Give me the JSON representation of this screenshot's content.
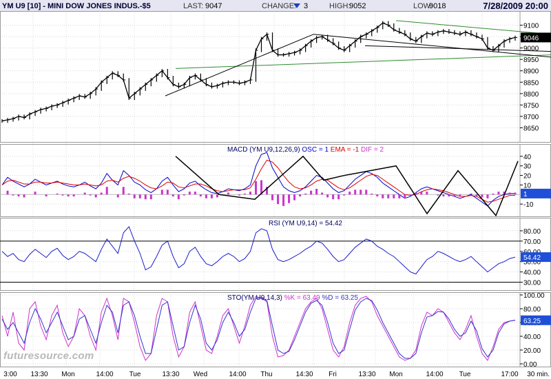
{
  "header": {
    "symbol_title": "YM U9 [10] - MINI DOW JONES INDUS.-$5",
    "last_label": "LAST:",
    "last_value": "9047",
    "change_label": "CHANGE:",
    "change_value": "3",
    "change_icon": "down-triangle-icon",
    "high_label": "HIGH:",
    "high_value": "9052",
    "low_label": "LOW:",
    "low_value": "9018",
    "datetime": "7/28/2009 20:00"
  },
  "watermark": "futuresource.com",
  "colors": {
    "price": "#000000",
    "trend_green": "#2e8b2e",
    "macd_blue": "#0000cc",
    "macd_red": "#dd0000",
    "macd_dif": "#cc33cc",
    "rsi": "#1a1acc",
    "stoch_k": "#cc33cc",
    "stoch_d": "#3333cc",
    "tag_blue": "#1f4fd8"
  },
  "chart_data": [
    {
      "type": "line",
      "title": "YM U9 [10] - MINI DOW JONES INDUS.-$5",
      "ylim": [
        8600,
        9150
      ],
      "yticks": [
        8650,
        8700,
        8750,
        8800,
        8850,
        8900,
        8950,
        9000,
        9050,
        9100
      ],
      "current_label": "9046",
      "x_labels": [
        "3:00",
        "13:30",
        "Mon",
        "14:00",
        "Tue",
        "13:30",
        "Wed",
        "14:00",
        "Thu",
        "14:30",
        "Fri",
        "13:30",
        "Mon",
        "14:00",
        "Tue",
        "17:00"
      ],
      "x_unit": "30 min.",
      "series": [
        {
          "values": [
            8680,
            8685,
            8690,
            8700,
            8695,
            8710,
            8720,
            8730,
            8735,
            8745,
            8750,
            8760,
            8770,
            8780,
            8790,
            8785,
            8800,
            8820,
            8850,
            8870,
            8890,
            8880,
            8860,
            8780,
            8800,
            8820,
            8840,
            8860,
            8880,
            8900,
            8870,
            8840,
            8830,
            8840,
            8870,
            8880,
            8860,
            8840,
            8830,
            8835,
            8845,
            8850,
            8850,
            8845,
            8850,
            8860,
            8990,
            9040,
            9060,
            8990,
            8970,
            8970,
            8975,
            8980,
            8990,
            9010,
            9030,
            9045,
            9050,
            9035,
            9020,
            9000,
            8990,
            9010,
            9030,
            9050,
            9060,
            9075,
            9090,
            9110,
            9100,
            9080,
            9070,
            9060,
            9040,
            9030,
            9050,
            9065,
            9060,
            9070,
            9075,
            9070,
            9065,
            9060,
            9070,
            9060,
            9050,
            9040,
            9000,
            8990,
            9010,
            9030,
            9040,
            9046
          ]
        }
      ],
      "trendlines": 6
    },
    {
      "type": "line",
      "title": "MACD (YM U9,12,26,9)",
      "legend": [
        {
          "label": "OSC = 1",
          "color": "#0000cc"
        },
        {
          "label": "EMA = -1",
          "color": "#dd0000"
        },
        {
          "label": "DIF = 2",
          "color": "#cc33cc"
        }
      ],
      "ylim": [
        -20,
        50
      ],
      "yticks": [
        40,
        30,
        20,
        10,
        -10
      ],
      "current_label": "1",
      "series": [
        {
          "name": "OSC",
          "values": [
            10,
            18,
            14,
            11,
            8,
            11,
            16,
            13,
            10,
            12,
            14,
            11,
            9,
            8,
            10,
            13,
            9,
            6,
            12,
            22,
            15,
            10,
            25,
            20,
            13,
            10,
            5,
            2,
            6,
            14,
            18,
            10,
            3,
            6,
            12,
            14,
            9,
            5,
            2,
            1,
            3,
            6,
            5,
            4,
            6,
            10,
            30,
            42,
            44,
            28,
            18,
            8,
            4,
            2,
            4,
            8,
            14,
            20,
            18,
            12,
            6,
            2,
            4,
            10,
            16,
            20,
            24,
            22,
            18,
            12,
            8,
            4,
            0,
            -4,
            -2,
            2,
            6,
            8,
            6,
            4,
            2,
            0,
            -2,
            -4,
            -2,
            0,
            -4,
            -8,
            -12,
            -6,
            -2,
            0,
            1,
            1
          ]
        },
        {
          "name": "EMA",
          "values": [
            10,
            14,
            15,
            13,
            11,
            11,
            13,
            13,
            12,
            12,
            13,
            12,
            11,
            10,
            10,
            11,
            10,
            9,
            10,
            14,
            15,
            13,
            17,
            19,
            17,
            14,
            10,
            7,
            6,
            9,
            13,
            12,
            8,
            7,
            9,
            11,
            11,
            9,
            6,
            4,
            3,
            4,
            5,
            5,
            5,
            7,
            16,
            27,
            36,
            34,
            28,
            20,
            13,
            8,
            6,
            7,
            10,
            14,
            16,
            15,
            11,
            7,
            5,
            7,
            11,
            15,
            19,
            21,
            20,
            16,
            12,
            8,
            4,
            0,
            -1,
            0,
            3,
            5,
            6,
            5,
            4,
            2,
            0,
            -2,
            -2,
            -1,
            -2,
            -5,
            -8,
            -7,
            -5,
            -3,
            -1,
            -1
          ]
        },
        {
          "name": "DIF",
          "values": [
            0,
            4,
            -1,
            -2,
            -3,
            0,
            3,
            0,
            -2,
            0,
            1,
            -1,
            -2,
            -2,
            0,
            2,
            -1,
            -3,
            2,
            8,
            0,
            -3,
            8,
            1,
            -4,
            -4,
            -5,
            -5,
            0,
            5,
            5,
            -2,
            -5,
            -1,
            3,
            3,
            -2,
            -4,
            -4,
            -3,
            0,
            2,
            0,
            -1,
            1,
            3,
            14,
            15,
            8,
            -6,
            -10,
            -12,
            -9,
            -6,
            -2,
            1,
            4,
            6,
            2,
            -3,
            -5,
            -5,
            -1,
            3,
            5,
            5,
            5,
            1,
            -2,
            -4,
            -4,
            -4,
            -4,
            -4,
            -1,
            2,
            3,
            3,
            0,
            -1,
            -2,
            -2,
            -2,
            -2,
            0,
            1,
            -2,
            -3,
            -4,
            1,
            3,
            3,
            2,
            2
          ]
        }
      ]
    },
    {
      "type": "line",
      "title": "RSI (YM U9,14) = 54.42",
      "ylim": [
        25,
        90
      ],
      "yticks": [
        80.0,
        70.0,
        60.0,
        50.0,
        40.0,
        30.0
      ],
      "reference_lines": [
        70,
        30
      ],
      "current_label": "54.42",
      "series": [
        {
          "name": "RSI",
          "values": [
            60,
            55,
            58,
            52,
            50,
            57,
            62,
            58,
            54,
            60,
            63,
            56,
            52,
            55,
            60,
            58,
            54,
            50,
            62,
            72,
            65,
            58,
            78,
            84,
            70,
            58,
            42,
            45,
            55,
            66,
            70,
            55,
            44,
            48,
            60,
            64,
            55,
            48,
            46,
            50,
            55,
            58,
            55,
            50,
            53,
            60,
            78,
            82,
            80,
            62,
            52,
            50,
            52,
            55,
            58,
            62,
            65,
            70,
            68,
            62,
            55,
            50,
            52,
            58,
            64,
            68,
            72,
            70,
            65,
            62,
            58,
            55,
            50,
            45,
            40,
            38,
            45,
            52,
            55,
            60,
            58,
            55,
            52,
            50,
            52,
            55,
            50,
            45,
            40,
            44,
            48,
            50,
            53,
            54.42
          ]
        }
      ]
    },
    {
      "type": "line",
      "title": "STO(YM U9,14,3)",
      "legend": [
        {
          "label": "%K = 63.49",
          "color": "#cc33cc"
        },
        {
          "label": "%D = 63.25",
          "color": "#3333cc"
        }
      ],
      "ylim": [
        0,
        100
      ],
      "yticks": [
        100.0,
        80.0,
        60.0,
        40.0,
        20.0,
        0.0
      ],
      "current_label": "63.25",
      "series": [
        {
          "name": "%K",
          "values": [
            70,
            40,
            75,
            30,
            20,
            80,
            90,
            55,
            35,
            70,
            85,
            45,
            25,
            40,
            80,
            70,
            40,
            20,
            75,
            95,
            70,
            35,
            95,
            90,
            60,
            25,
            5,
            15,
            70,
            95,
            90,
            40,
            10,
            25,
            75,
            90,
            55,
            20,
            15,
            40,
            70,
            80,
            55,
            30,
            55,
            85,
            98,
            95,
            90,
            40,
            10,
            12,
            20,
            40,
            60,
            80,
            90,
            95,
            80,
            50,
            20,
            10,
            25,
            60,
            85,
            95,
            98,
            90,
            70,
            55,
            40,
            25,
            10,
            5,
            8,
            20,
            55,
            75,
            70,
            80,
            75,
            60,
            45,
            35,
            50,
            70,
            40,
            15,
            5,
            25,
            50,
            60,
            62,
            63.49
          ]
        },
        {
          "name": "%D",
          "values": [
            65,
            50,
            60,
            45,
            30,
            60,
            80,
            65,
            45,
            60,
            75,
            55,
            35,
            40,
            65,
            70,
            50,
            30,
            60,
            85,
            75,
            45,
            85,
            90,
            70,
            40,
            15,
            15,
            50,
            85,
            90,
            55,
            20,
            25,
            60,
            85,
            65,
            30,
            20,
            35,
            60,
            75,
            60,
            40,
            50,
            75,
            95,
            96,
            92,
            55,
            20,
            15,
            18,
            35,
            55,
            75,
            88,
            92,
            85,
            60,
            30,
            15,
            20,
            50,
            78,
            90,
            95,
            92,
            78,
            60,
            45,
            30,
            15,
            8,
            8,
            15,
            45,
            68,
            70,
            76,
            75,
            65,
            50,
            40,
            45,
            62,
            48,
            22,
            10,
            20,
            45,
            58,
            62,
            63.25
          ]
        }
      ]
    }
  ]
}
